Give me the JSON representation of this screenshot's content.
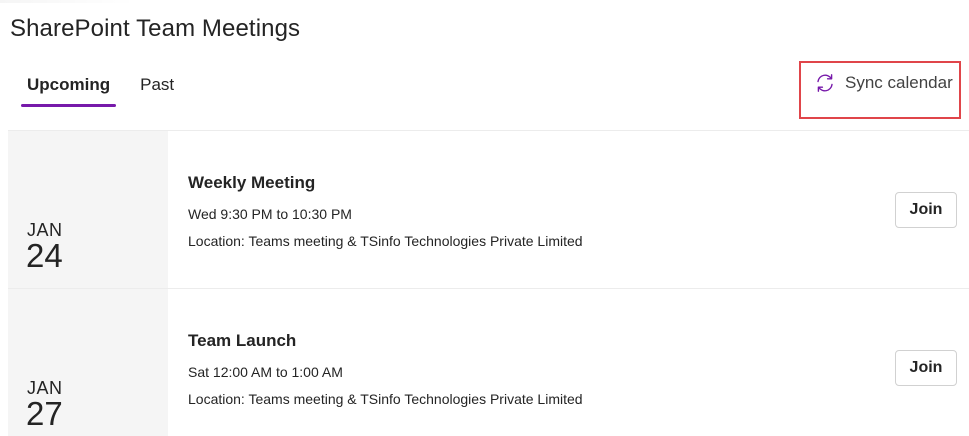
{
  "header": {
    "title": "SharePoint Team Meetings"
  },
  "tabs": [
    {
      "label": "Upcoming",
      "active": true
    },
    {
      "label": "Past",
      "active": false
    }
  ],
  "sync": {
    "label": "Sync calendar",
    "icon": "sync-icon"
  },
  "events": [
    {
      "month": "JAN",
      "day": "24",
      "title": "Weekly Meeting",
      "time": "Wed 9:30 PM to 10:30 PM",
      "location": "Location: Teams meeting & TSinfo Technologies Private Limited",
      "join_label": "Join"
    },
    {
      "month": "JAN",
      "day": "27",
      "title": "Team Launch",
      "time": "Sat 12:00 AM to 1:00 AM",
      "location": "Location: Teams meeting & TSinfo Technologies Private Limited",
      "join_label": "Join"
    }
  ],
  "colors": {
    "tab_indicator": "#7719aa",
    "sync_icon": "#7719aa",
    "highlight_box": "#e0454a",
    "date_column_bg": "#f5f5f5"
  }
}
